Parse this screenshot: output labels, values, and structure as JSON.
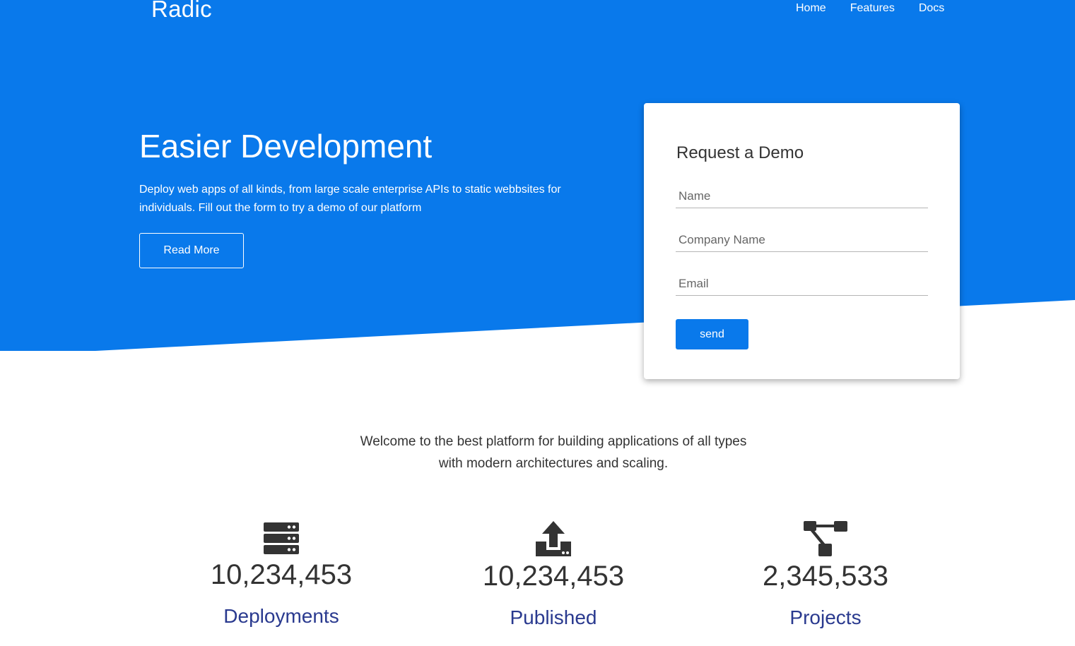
{
  "brand": {
    "name": "Radic"
  },
  "nav": {
    "items": [
      "Home",
      "Features",
      "Docs"
    ]
  },
  "hero": {
    "title": "Easier Development",
    "line1": "Deploy web apps of all kinds, from large scale enterprise APIs to static webbsites for",
    "line2": "individuals. Fill out the form to try a demo of our platform",
    "read_more_label": "Read More"
  },
  "demo_form": {
    "title": "Request a Demo",
    "name_placeholder": "Name",
    "company_placeholder": "Company Name",
    "email_placeholder": "Email",
    "send_label": "send"
  },
  "welcome": {
    "line1": "Welcome to the best platform for building applications of all types",
    "line2": "with modern architectures and scaling."
  },
  "stats": [
    {
      "icon": "server-icon",
      "value": "10,234,453",
      "label": "Deployments"
    },
    {
      "icon": "upload-icon",
      "value": "10,234,453",
      "label": "Published"
    },
    {
      "icon": "sitemap-icon",
      "value": "2,345,533",
      "label": "Projects"
    }
  ],
  "colors": {
    "primary": "#0979eb",
    "stat_label": "#2a3a8f",
    "text_dark": "#333333"
  }
}
